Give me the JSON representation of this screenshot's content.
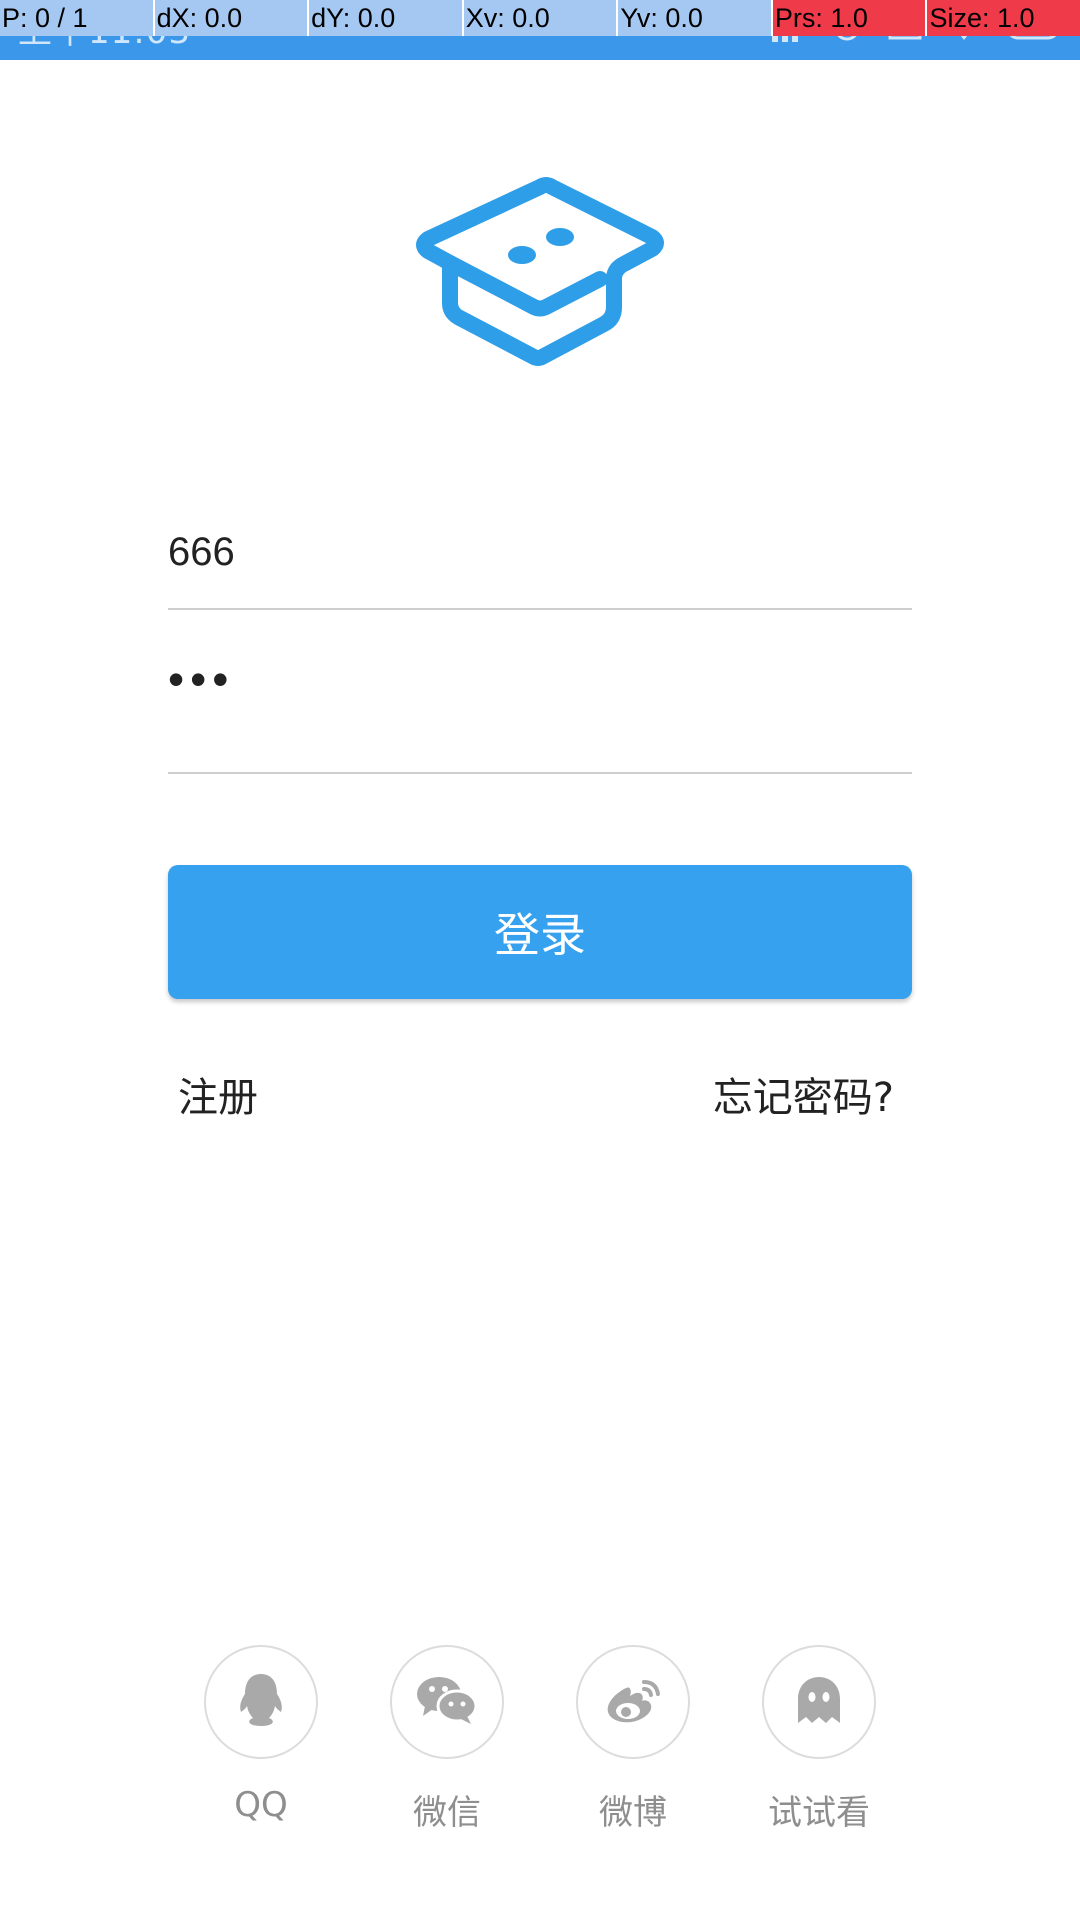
{
  "status_bar": {
    "time": "上午11:03",
    "icons": [
      "signal-icon",
      "alarm-icon",
      "notification-icon",
      "wifi-icon",
      "battery-icon"
    ]
  },
  "debug_overlay": {
    "pointer": "P: 0 / 1",
    "dx": "dX: 0.0",
    "dy": "dY: 0.0",
    "xv": "Xv: 0.0",
    "yv": "Yv: 0.0",
    "prs": "Prs: 1.0",
    "size": "Size: 1.0"
  },
  "logo": {
    "icon": "graduation-cap-logo",
    "color": "#2f9ee8"
  },
  "form": {
    "username_value": "666",
    "password_value": "•••"
  },
  "login_button": {
    "label": "登录",
    "color": "#35a1ef"
  },
  "links": {
    "register": "注册",
    "forgot_password": "忘记密码?"
  },
  "third_party": [
    {
      "icon": "qq-icon",
      "label": "QQ"
    },
    {
      "icon": "wechat-icon",
      "label": "微信"
    },
    {
      "icon": "weibo-icon",
      "label": "微博"
    },
    {
      "icon": "ghost-icon",
      "label": "试试看"
    }
  ]
}
